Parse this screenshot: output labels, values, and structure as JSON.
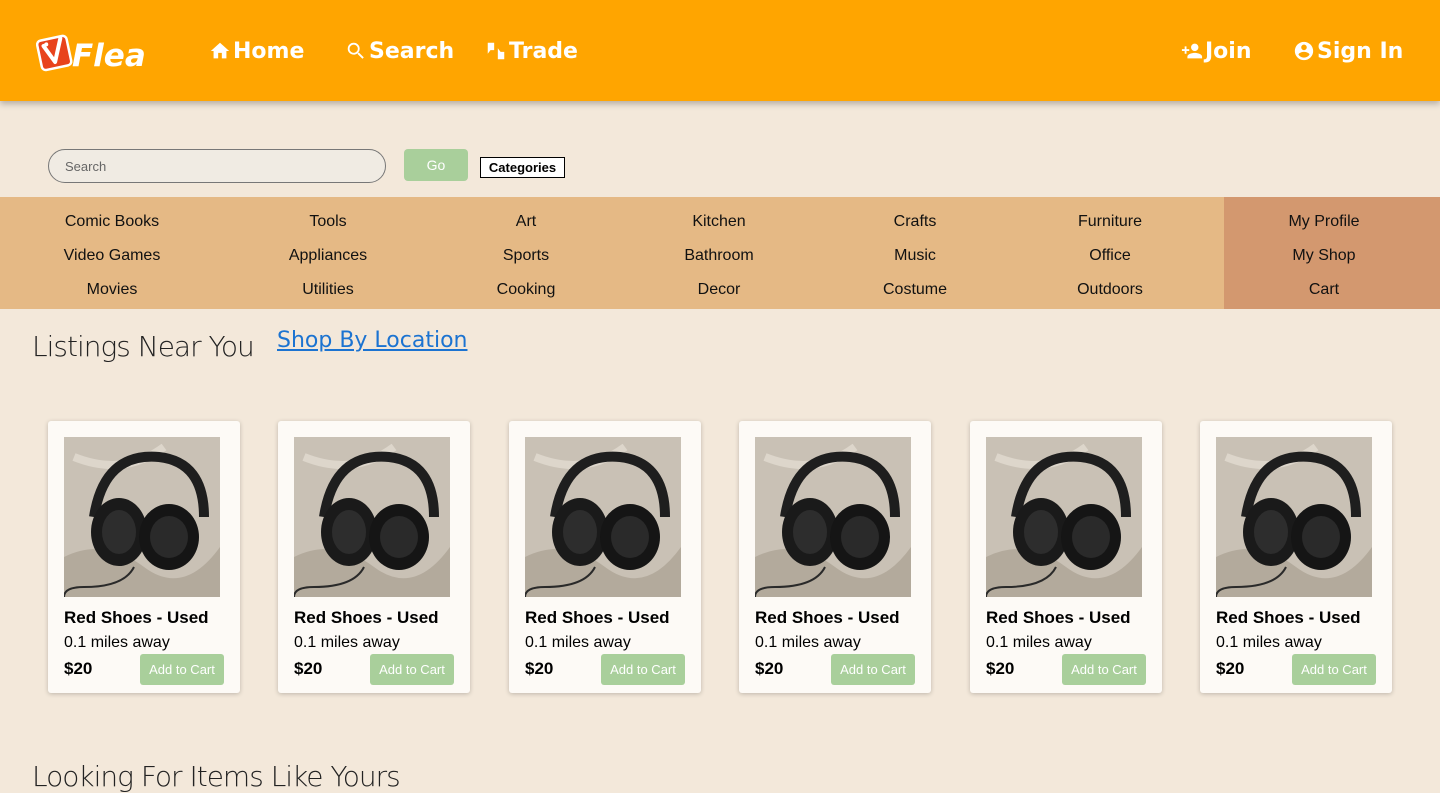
{
  "colors": {
    "header": "#ffa500",
    "page_bg": "#f3e8da",
    "category_bar": "#e5b985",
    "account_panel": "#d3986f",
    "button_green": "#a9cf9b",
    "link": "#1b73d1"
  },
  "header": {
    "logo_text": "Flea",
    "nav": [
      {
        "label": "Home",
        "icon": "home-icon"
      },
      {
        "label": "Search",
        "icon": "search-icon"
      },
      {
        "label": "Trade",
        "icon": "trade-icon"
      }
    ],
    "account": [
      {
        "label": "Join",
        "icon": "add-person-icon"
      },
      {
        "label": "Sign In",
        "icon": "account-circle-icon"
      }
    ]
  },
  "search": {
    "placeholder": "Search",
    "go_label": "Go",
    "categories_label": "Categories"
  },
  "categories": {
    "columns": [
      [
        "Comic Books",
        "Video Games",
        "Movies"
      ],
      [
        "Tools",
        "Appliances",
        "Utilities"
      ],
      [
        "Art",
        "Sports",
        "Cooking"
      ],
      [
        "Kitchen",
        "Bathroom",
        "Decor"
      ],
      [
        "Crafts",
        "Music",
        "Costume"
      ],
      [
        "Furniture",
        "Office",
        "Outdoors"
      ]
    ],
    "account_links": [
      "My Profile",
      "My Shop",
      "Cart"
    ]
  },
  "listings": {
    "title": "Listings Near You",
    "shop_by_location": "Shop By Location",
    "items": [
      {
        "title": "Red Shoes - Used",
        "distance": "0.1 miles away",
        "price": "$20",
        "button": "Add to Cart",
        "image": "headphones-photo"
      },
      {
        "title": "Red Shoes - Used",
        "distance": "0.1 miles away",
        "price": "$20",
        "button": "Add to Cart",
        "image": "headphones-photo"
      },
      {
        "title": "Red Shoes - Used",
        "distance": "0.1 miles away",
        "price": "$20",
        "button": "Add to Cart",
        "image": "headphones-photo"
      },
      {
        "title": "Red Shoes - Used",
        "distance": "0.1 miles away",
        "price": "$20",
        "button": "Add to Cart",
        "image": "headphones-photo"
      },
      {
        "title": "Red Shoes - Used",
        "distance": "0.1 miles away",
        "price": "$20",
        "button": "Add to Cart",
        "image": "headphones-photo"
      },
      {
        "title": "Red Shoes - Used",
        "distance": "0.1 miles away",
        "price": "$20",
        "button": "Add to Cart",
        "image": "headphones-photo"
      }
    ]
  },
  "similar": {
    "title": "Looking For Items Like Yours"
  }
}
